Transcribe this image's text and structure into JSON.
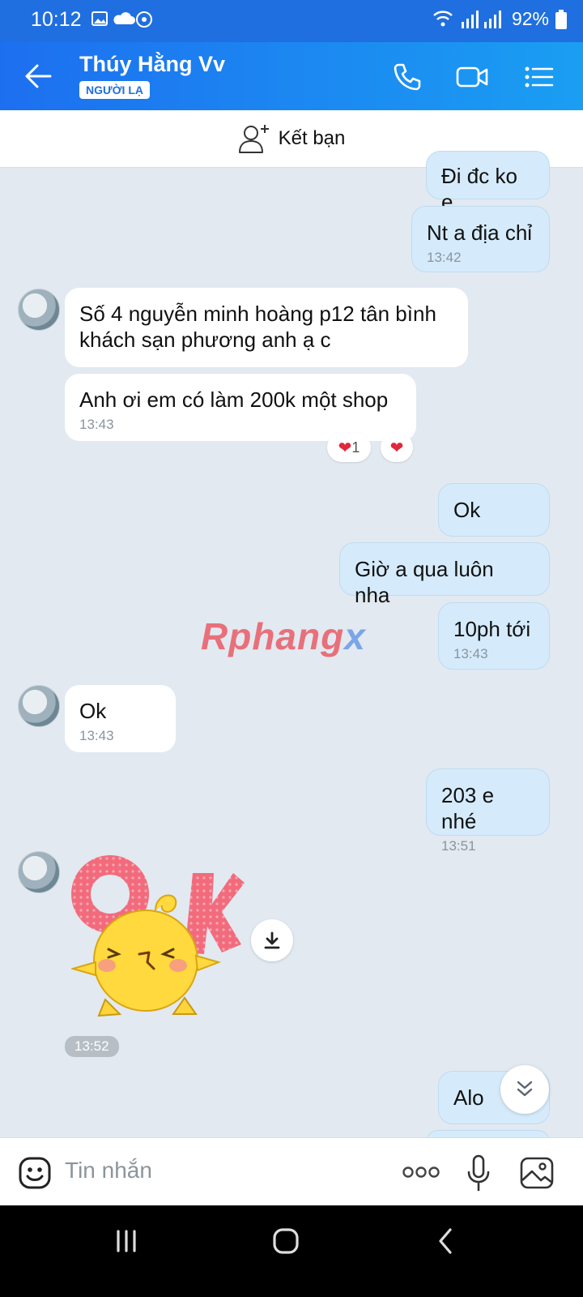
{
  "status": {
    "time": "10:12",
    "battery": "92%"
  },
  "header": {
    "contact_name": "Thúy Hằng Vv",
    "badge": "NGƯỜI LẠ"
  },
  "friend_bar": {
    "label": "Kết bạn"
  },
  "messages": {
    "m1": {
      "text": "Đi đc ko e"
    },
    "m2": {
      "text": "Nt a địa chỉ",
      "time": "13:42"
    },
    "m3": {
      "line1": "Số 4 nguyễn minh hoàng p12 tân bình",
      "line2": "khách sạn phương anh ạ c"
    },
    "m4": {
      "text": "Anh ơi em có làm 200k một shop",
      "time": "13:43",
      "reaction_count": "1"
    },
    "m5": {
      "text": "Ok"
    },
    "m6": {
      "text": "Giờ a qua luôn nha"
    },
    "m7": {
      "text": "10ph tới",
      "time": "13:43"
    },
    "m8": {
      "text": "Ok",
      "time": "13:43"
    },
    "m9": {
      "text": "203 e nhé",
      "time": "13:51"
    },
    "sticker": {
      "text": "Ok",
      "time": "13:52"
    },
    "m10": {
      "text": "Alo"
    }
  },
  "watermark": {
    "part1": "Rphang",
    "part2": "x"
  },
  "input": {
    "placeholder": "Tin nhắn"
  },
  "colors": {
    "header": "#1d6ff0",
    "sent_bubble": "#d5ebfb",
    "received_bubble": "#ffffff",
    "background": "#e2e9f1",
    "heart": "#e0283c"
  },
  "icons": [
    "back-arrow-icon",
    "phone-icon",
    "video-call-icon",
    "menu-list-icon",
    "add-friend-icon",
    "heart-icon",
    "download-icon",
    "chevron-down-icon",
    "emoji-icon",
    "more-dots-icon",
    "microphone-icon",
    "image-icon",
    "nav-recents-icon",
    "nav-home-icon",
    "nav-back-icon"
  ]
}
